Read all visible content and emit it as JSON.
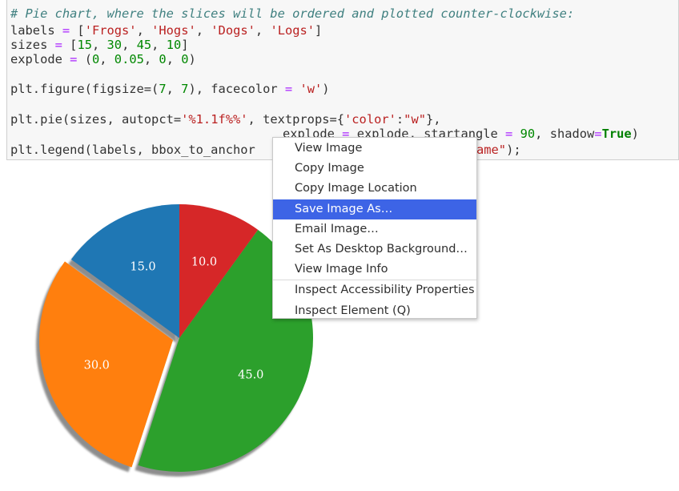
{
  "code": {
    "line1": "# Pie chart, where the slices will be ordered and plotted counter-clockwise:",
    "labels_var": "labels",
    "labels_values": [
      "'Frogs'",
      "'Hogs'",
      "'Dogs'",
      "'Logs'"
    ],
    "sizes_var": "sizes",
    "sizes_values": [
      "15",
      "30",
      "45",
      "10"
    ],
    "explode_var": "explode",
    "explode_values": [
      "0",
      "0.05",
      "0",
      "0"
    ],
    "figure_prefix": "plt.figure(figsize=(",
    "figure_w": "7",
    "figure_h": "7",
    "figure_mid": "), facecolor ",
    "figure_fc": "'w'",
    "pie_prefix": "plt.pie(sizes, autopct=",
    "pie_autopct": "'%1.1f%%'",
    "pie_textprops": "textprops={",
    "pie_color_key": "'color'",
    "pie_color_val": "\"w\"",
    "pie_cont_explode": "explode ",
    "pie_cont_explode_val": "explode",
    "pie_cont_start": "startangle ",
    "pie_cont_start_val": "90",
    "pie_cont_shadow": "shadow",
    "pie_cont_true": "True",
    "legend_prefix": "plt.legend(labels, bbox_to_anchor ",
    "legend_suffix_str": "ame\"",
    "legend_suffix_end": ");"
  },
  "chart_data": {
    "type": "pie",
    "values": [
      15.0,
      30.0,
      45.0,
      10.0
    ],
    "data_labels": [
      "15.0",
      "30.0",
      "45.0",
      "10.0"
    ],
    "explode": [
      0,
      0.05,
      0,
      0
    ],
    "startangle": 90,
    "direction": "counter-clockwise",
    "shadow": true,
    "colors": [
      "#1f77b4",
      "#ff7f0e",
      "#2ca02c",
      "#d62728"
    ]
  },
  "context_menu": {
    "items": [
      {
        "label": "View Image"
      },
      {
        "label": "Copy Image"
      },
      {
        "label": "Copy Image Location"
      },
      {
        "label": "Save Image As…",
        "selected": true
      },
      {
        "label": "Email Image…"
      },
      {
        "label": "Set As Desktop Background…"
      },
      {
        "label": "View Image Info"
      },
      {
        "label": "Inspect Accessibility Properties"
      },
      {
        "label": "Inspect Element (Q)"
      }
    ],
    "selected_color": "#3d64e6"
  }
}
